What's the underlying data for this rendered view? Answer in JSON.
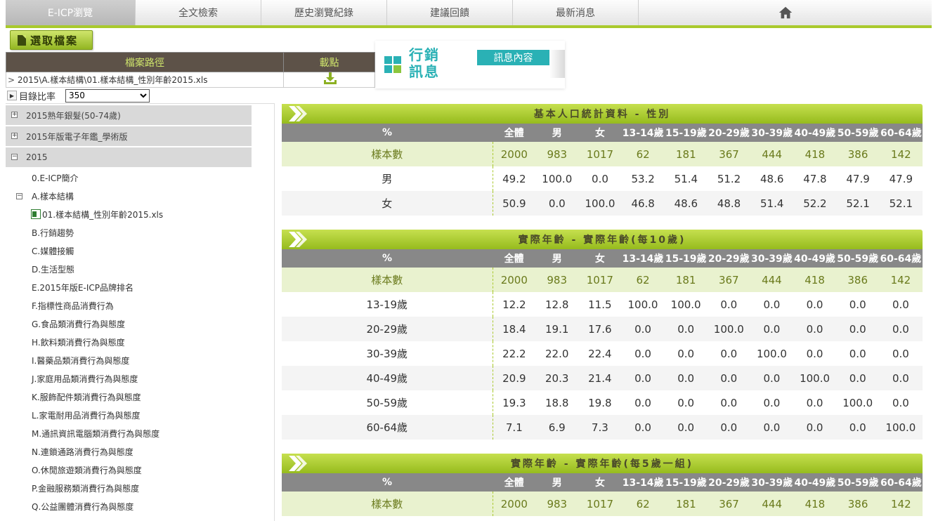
{
  "nav": {
    "items": [
      {
        "label": "E-ICP瀏覽"
      },
      {
        "label": "全文檢索"
      },
      {
        "label": "歷史瀏覽紀錄"
      },
      {
        "label": "建議回饋"
      },
      {
        "label": "最新消息"
      }
    ]
  },
  "file": {
    "select_label": "選取檔案",
    "path_header": "檔案路徑",
    "download_header": "載點",
    "path_prefix": ">",
    "path_value": "2015\\A.樣本結構\\01.樣本結構_性別年齡2015.xls"
  },
  "ratio": {
    "label": "目錄比率",
    "selected": "350"
  },
  "promo": {
    "title": "行銷訊息",
    "tab": "訊息內容"
  },
  "tree": {
    "groups": [
      {
        "label": "2015熟年銀髮(50-74歲)",
        "toggle": "+"
      },
      {
        "label": "2015年版電子年鑑_學術版",
        "toggle": "+"
      },
      {
        "label": "2015",
        "toggle": "−"
      }
    ],
    "intro": "0.E-ICP簡介",
    "sub_folder": "A.樣本結構",
    "file": "01.樣本結構_性別年齡2015.xls",
    "items": [
      "B.行銷趨勢",
      "C.媒體接觸",
      "D.生活型態",
      "E.2015年版E-ICP品牌排名",
      "F.指標性商品消費行為",
      "G.食品類消費行為與態度",
      "H.飲料類消費行為與態度",
      "I.醫藥品類消費行為與態度",
      "J.家庭用品類消費行為與態度",
      "K.服飾配件類消費行為與態度",
      "L.家電耐用品消費行為與態度",
      "M.通訊資訊電腦類消費行為與態度",
      "N.連鎖通路消費行為與態度",
      "O.休閒旅遊類消費行為與態度",
      "P.金融服務類消費行為與態度",
      "Q.公益團體消費行為與態度"
    ]
  },
  "columns": [
    "%",
    "全體",
    "男",
    "女",
    "13-14歲",
    "15-19歲",
    "20-29歲",
    "30-39歲",
    "40-49歲",
    "50-59歲",
    "60-64歲"
  ],
  "sections": [
    {
      "title": "基本人口統計資料 - 性別",
      "rows": [
        {
          "label": "樣本數",
          "values": [
            "2000",
            "983",
            "1017",
            "62",
            "181",
            "367",
            "444",
            "418",
            "386",
            "142"
          ]
        },
        {
          "label": "男",
          "values": [
            "49.2",
            "100.0",
            "0.0",
            "53.2",
            "51.4",
            "51.2",
            "48.6",
            "47.8",
            "47.9",
            "47.9"
          ]
        },
        {
          "label": "女",
          "values": [
            "50.9",
            "0.0",
            "100.0",
            "46.8",
            "48.6",
            "48.8",
            "51.4",
            "52.2",
            "52.1",
            "52.1"
          ]
        }
      ]
    },
    {
      "title": "實際年齡 - 實際年齡(每10歲)",
      "rows": [
        {
          "label": "樣本數",
          "values": [
            "2000",
            "983",
            "1017",
            "62",
            "181",
            "367",
            "444",
            "418",
            "386",
            "142"
          ]
        },
        {
          "label": "13-19歲",
          "values": [
            "12.2",
            "12.8",
            "11.5",
            "100.0",
            "100.0",
            "0.0",
            "0.0",
            "0.0",
            "0.0",
            "0.0"
          ]
        },
        {
          "label": "20-29歲",
          "values": [
            "18.4",
            "19.1",
            "17.6",
            "0.0",
            "0.0",
            "100.0",
            "0.0",
            "0.0",
            "0.0",
            "0.0"
          ]
        },
        {
          "label": "30-39歲",
          "values": [
            "22.2",
            "22.0",
            "22.4",
            "0.0",
            "0.0",
            "0.0",
            "100.0",
            "0.0",
            "0.0",
            "0.0"
          ]
        },
        {
          "label": "40-49歲",
          "values": [
            "20.9",
            "20.3",
            "21.4",
            "0.0",
            "0.0",
            "0.0",
            "0.0",
            "100.0",
            "0.0",
            "0.0"
          ]
        },
        {
          "label": "50-59歲",
          "values": [
            "19.3",
            "18.8",
            "19.8",
            "0.0",
            "0.0",
            "0.0",
            "0.0",
            "0.0",
            "100.0",
            "0.0"
          ]
        },
        {
          "label": "60-64歲",
          "values": [
            "7.1",
            "6.9",
            "7.3",
            "0.0",
            "0.0",
            "0.0",
            "0.0",
            "0.0",
            "0.0",
            "100.0"
          ]
        }
      ]
    },
    {
      "title": "實際年齡 - 實際年齡(每5歲一組)",
      "rows": [
        {
          "label": "樣本數",
          "values": [
            "2000",
            "983",
            "1017",
            "62",
            "181",
            "367",
            "444",
            "418",
            "386",
            "142"
          ]
        }
      ]
    }
  ]
}
